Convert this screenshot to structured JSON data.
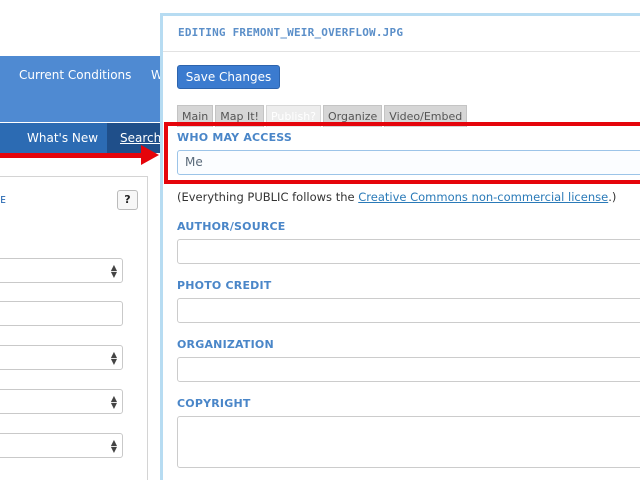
{
  "background": {
    "nav": {
      "current_conditions": "Current Conditions",
      "next_item": "W"
    },
    "subnav": {
      "whats_new": "What's New",
      "search": "Search"
    },
    "panel": {
      "help_label": "?",
      "accent_glyph": "ᴇ",
      "dropdown_glyph": "▲▼"
    }
  },
  "modal": {
    "title": "EDITING FREMONT_WEIR_OVERFLOW.JPG",
    "save_label": "Save Changes",
    "tabs": [
      {
        "label": "Main",
        "active": false
      },
      {
        "label": "Map It!",
        "active": false
      },
      {
        "label": "Publish?",
        "active": true
      },
      {
        "label": "Organize",
        "active": false
      },
      {
        "label": "Video/Embed",
        "active": false
      }
    ],
    "who_may_access": {
      "label": "WHO MAY ACCESS",
      "value": "Me"
    },
    "license_note": {
      "prefix": "(Everything PUBLIC follows the ",
      "link_text": "Creative Commons non-commercial license",
      "suffix": ".)"
    },
    "author_source": {
      "label": "AUTHOR/SOURCE",
      "value": ""
    },
    "photo_credit": {
      "label": "PHOTO CREDIT",
      "value": ""
    },
    "organization": {
      "label": "ORGANIZATION",
      "value": ""
    },
    "copyright": {
      "label": "COPYRIGHT",
      "value": ""
    }
  },
  "annotation": {
    "color": "#e5040b",
    "highlight_target": "who-may-access-field"
  }
}
